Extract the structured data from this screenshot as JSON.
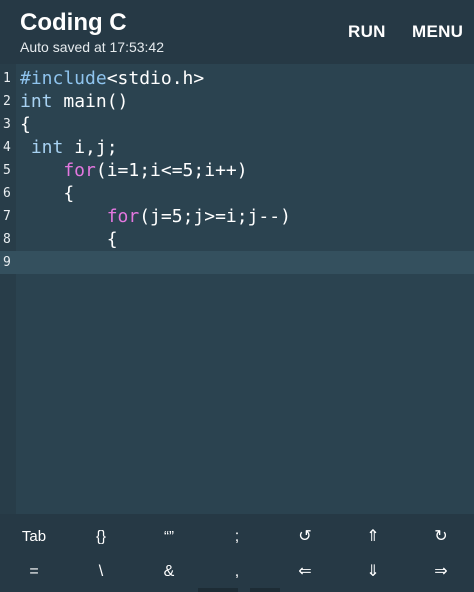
{
  "app": {
    "title": "Coding C",
    "status": "Auto saved at 17:53:42",
    "actions": {
      "run": "RUN",
      "menu": "MENU"
    }
  },
  "editor": {
    "active_line": 9,
    "lines": [
      {
        "num": "1",
        "tokens": [
          {
            "t": "#include",
            "c": "pre"
          },
          {
            "t": "<stdio.h>",
            "c": "plain"
          }
        ]
      },
      {
        "num": "2",
        "tokens": [
          {
            "t": "int",
            "c": "type"
          },
          {
            "t": " main()",
            "c": "plain"
          }
        ]
      },
      {
        "num": "3",
        "tokens": [
          {
            "t": "{",
            "c": "plain"
          }
        ]
      },
      {
        "num": "4",
        "tokens": [
          {
            "t": " int",
            "c": "type"
          },
          {
            "t": " i,j;",
            "c": "plain"
          }
        ]
      },
      {
        "num": "5",
        "tokens": [
          {
            "t": "    for",
            "c": "kw"
          },
          {
            "t": "(i=1;i<=5;i++)",
            "c": "plain"
          }
        ]
      },
      {
        "num": "6",
        "tokens": [
          {
            "t": "    {",
            "c": "plain"
          }
        ]
      },
      {
        "num": "7",
        "tokens": [
          {
            "t": "        for",
            "c": "kw"
          },
          {
            "t": "(j=5;j>=i;j--)",
            "c": "plain"
          }
        ]
      },
      {
        "num": "8",
        "tokens": [
          {
            "t": "        {",
            "c": "plain"
          }
        ]
      },
      {
        "num": "9",
        "tokens": []
      }
    ]
  },
  "keyboard": {
    "row1": [
      {
        "label": "Tab",
        "name": "tab-key"
      },
      {
        "label": "{}",
        "name": "braces-key"
      },
      {
        "label": "“”",
        "name": "quotes-key"
      },
      {
        "label": ";",
        "name": "semicolon-key"
      },
      {
        "label": "↺",
        "name": "undo-key"
      },
      {
        "label": "⇑",
        "name": "arrow-up-key"
      },
      {
        "label": "↻",
        "name": "redo-key"
      }
    ],
    "row2": [
      {
        "label": "=",
        "name": "equals-key"
      },
      {
        "label": "\\",
        "name": "backslash-key"
      },
      {
        "label": "&",
        "name": "ampersand-key"
      },
      {
        "label": ",",
        "name": "comma-key"
      },
      {
        "label": "⇐",
        "name": "arrow-left-key"
      },
      {
        "label": "⇓",
        "name": "arrow-down-key"
      },
      {
        "label": "⇒",
        "name": "arrow-right-key"
      }
    ]
  },
  "colors": {
    "background": "#263945",
    "editor": "#2b4350",
    "active_line": "#34505e",
    "keyword": "#e377df",
    "preprocessor": "#8fc4ee",
    "type": "#a8d2f2"
  }
}
